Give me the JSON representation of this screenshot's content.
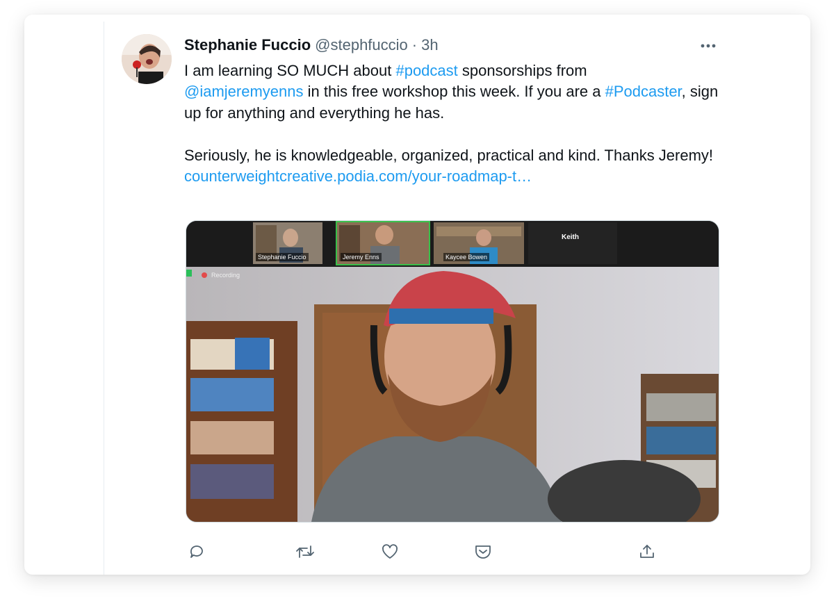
{
  "tweet": {
    "author_name": "Stephanie Fuccio",
    "author_handle": "@stephfuccio",
    "separator": "·",
    "timestamp": "3h",
    "text": {
      "p1_a": "I am learning SO MUCH about ",
      "hashtag_podcast": "#podcast",
      "p1_b": " sponsorships from ",
      "mention": "@iamjeremyenns",
      "p1_c": " in this free workshop this week. If you are a ",
      "hashtag_podcaster": "#Podcaster",
      "p1_d": ", sign up for anything and everything he has.",
      "p2": "Seriously, he is knowledgeable, organized, practical and kind. Thanks Jeremy!",
      "link": "counterweightcreative.podia.com/your-roadmap-t…"
    }
  },
  "media": {
    "participants": [
      "Stephanie Fuccio",
      "Jeremy Enns",
      "Kaycee Bowen",
      "Keith"
    ],
    "recording_label": "Recording"
  },
  "icons": {
    "more": "more-horizontal-icon",
    "reply": "reply-icon",
    "retweet": "retweet-icon",
    "like": "heart-icon",
    "save": "pocket-save-icon",
    "share": "share-icon"
  },
  "colors": {
    "accent": "#1d9bf0",
    "text": "#0f1419",
    "muted": "#536471"
  }
}
